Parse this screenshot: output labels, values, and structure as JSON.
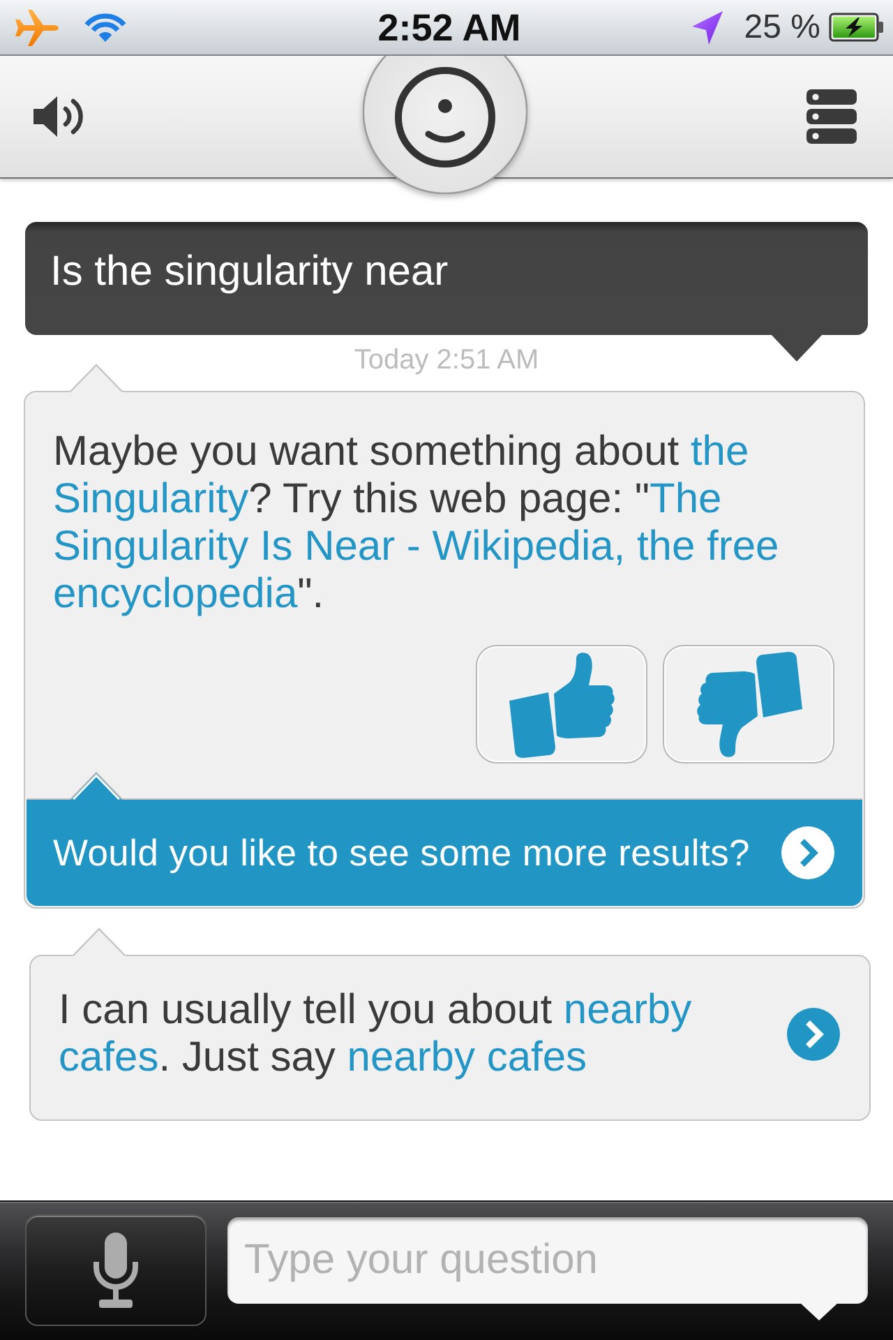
{
  "status_bar": {
    "time": "2:52 AM",
    "battery": "25 %"
  },
  "conversation": [
    {
      "kind": "user",
      "text": "Is the singularity near"
    },
    {
      "kind": "timestamp",
      "text": "Today 2:51 AM"
    },
    {
      "kind": "answer",
      "lines": [
        [
          {
            "kind": "text",
            "text": "Maybe you want something about "
          },
          {
            "kind": "link",
            "text": "the"
          }
        ],
        [
          {
            "kind": "link",
            "text": "Singularity"
          },
          {
            "kind": "text",
            "text": "? Try this web page: \""
          },
          {
            "kind": "link",
            "text": "The"
          }
        ],
        [
          {
            "kind": "link",
            "text": "Singularity Is Near - Wikipedia, the free"
          }
        ],
        [
          {
            "kind": "link",
            "text": "encyclopedia"
          },
          {
            "kind": "text",
            "text": "\"."
          }
        ]
      ],
      "more_button": "Would you like to see some more results?"
    },
    {
      "kind": "suggestion",
      "lines": [
        [
          {
            "kind": "text",
            "text": "I can usually tell you about "
          },
          {
            "kind": "link",
            "text": "nearby"
          }
        ],
        [
          {
            "kind": "link",
            "text": "cafes"
          },
          {
            "kind": "text",
            "text": ". Just say "
          },
          {
            "kind": "link",
            "text": "nearby cafes"
          }
        ]
      ]
    }
  ],
  "input": {
    "placeholder": "Type your question"
  }
}
